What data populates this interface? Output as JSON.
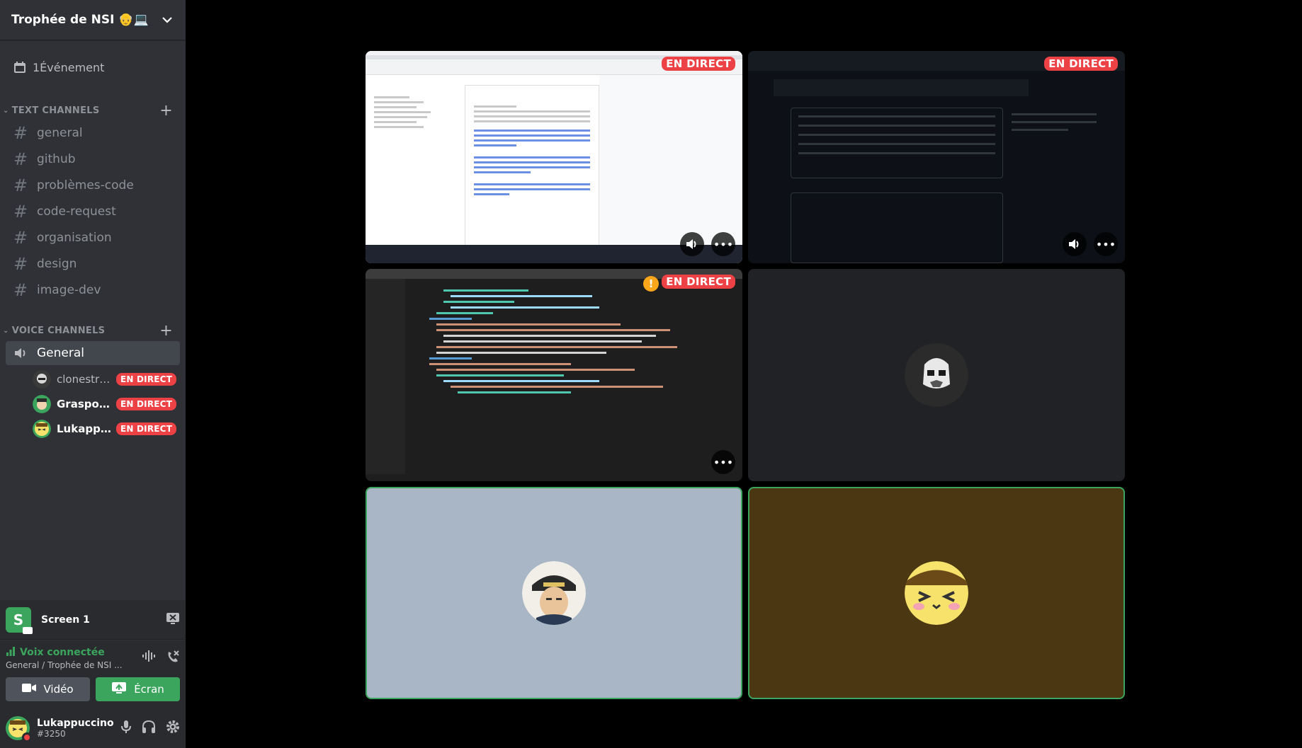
{
  "server": {
    "name": "Trophée de NSI 👴💻"
  },
  "events": {
    "label": "1Événement"
  },
  "text_category": {
    "label": "TEXT CHANNELS"
  },
  "text_channels": [
    "general",
    "github",
    "problèmes-code",
    "code-request",
    "organisation",
    "design",
    "image-dev"
  ],
  "voice_category": {
    "label": "VOICE CHANNELS"
  },
  "voice_channel": {
    "label": "General"
  },
  "voice_users": [
    {
      "name": "clonestrik...",
      "badge": "EN DIRECT"
    },
    {
      "name": "Graspou ...",
      "badge": "EN DIRECT"
    },
    {
      "name": "Lukappuc...",
      "badge": "EN DIRECT"
    }
  ],
  "screen_panel": {
    "icon_letter": "S",
    "label": "Screen 1"
  },
  "voice_panel": {
    "status": "Voix connectée",
    "location": "General / Trophée de NSI ...",
    "video_label": "Vidéo",
    "screen_label": "Écran"
  },
  "user": {
    "name": "Lukappuccino",
    "tag": "#3250"
  },
  "tiles": {
    "live_label": "EN DIRECT"
  },
  "colors": {
    "live": "#ed4245",
    "connected": "#3ba55d",
    "sidebar": "#2f3136",
    "panel": "#292b2f"
  }
}
